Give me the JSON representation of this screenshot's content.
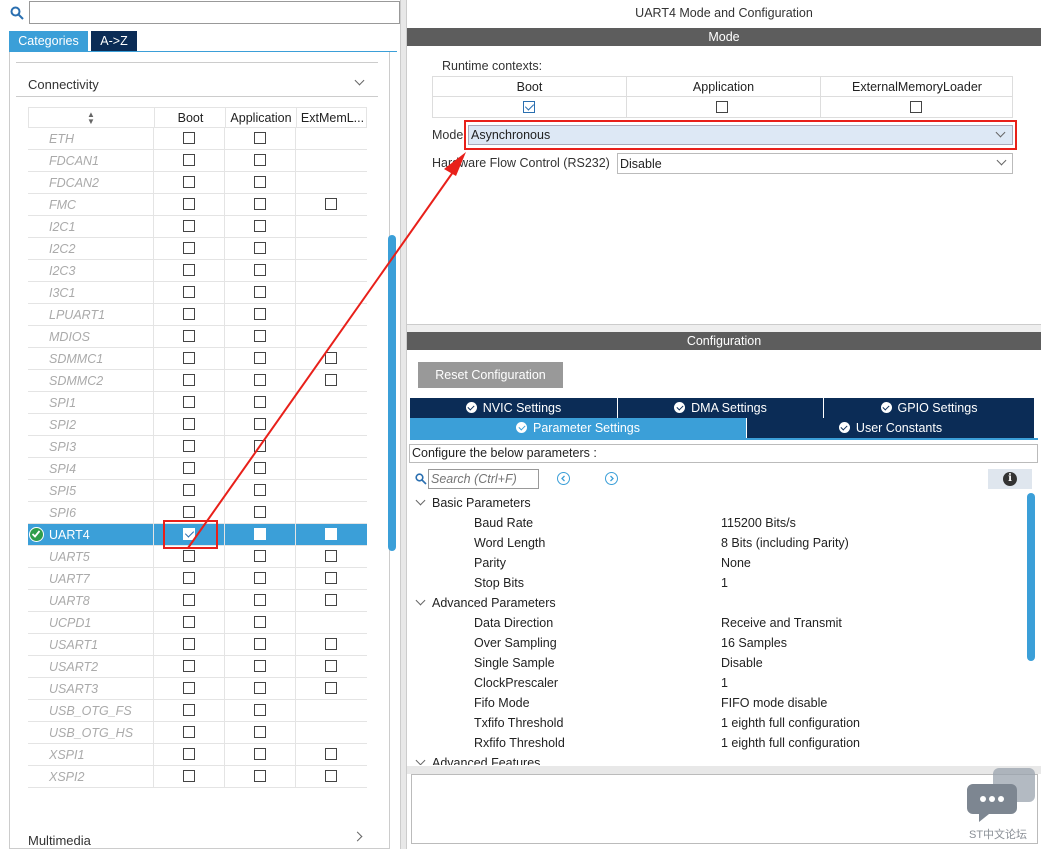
{
  "left": {
    "search_placeholder": "",
    "tabs": [
      "Categories",
      "A->Z"
    ],
    "group_title": "Connectivity",
    "bottom_group": "Multimedia",
    "columns": {
      "boot": "Boot",
      "application": "Application",
      "extmem": "ExtMemL..."
    },
    "rows": [
      {
        "name": "ETH",
        "boot": false,
        "app": false,
        "ext": null
      },
      {
        "name": "FDCAN1",
        "boot": false,
        "app": false,
        "ext": null
      },
      {
        "name": "FDCAN2",
        "boot": false,
        "app": false,
        "ext": null
      },
      {
        "name": "FMC",
        "boot": false,
        "app": false,
        "ext": false
      },
      {
        "name": "I2C1",
        "boot": false,
        "app": false,
        "ext": null
      },
      {
        "name": "I2C2",
        "boot": false,
        "app": false,
        "ext": null
      },
      {
        "name": "I2C3",
        "boot": false,
        "app": false,
        "ext": null
      },
      {
        "name": "I3C1",
        "boot": false,
        "app": false,
        "ext": null
      },
      {
        "name": "LPUART1",
        "boot": false,
        "app": false,
        "ext": null
      },
      {
        "name": "MDIOS",
        "boot": false,
        "app": false,
        "ext": null
      },
      {
        "name": "SDMMC1",
        "boot": false,
        "app": false,
        "ext": false
      },
      {
        "name": "SDMMC2",
        "boot": false,
        "app": false,
        "ext": false
      },
      {
        "name": "SPI1",
        "boot": false,
        "app": false,
        "ext": null
      },
      {
        "name": "SPI2",
        "boot": false,
        "app": false,
        "ext": null
      },
      {
        "name": "SPI3",
        "boot": false,
        "app": false,
        "ext": null
      },
      {
        "name": "SPI4",
        "boot": false,
        "app": false,
        "ext": null
      },
      {
        "name": "SPI5",
        "boot": false,
        "app": false,
        "ext": null
      },
      {
        "name": "SPI6",
        "boot": false,
        "app": false,
        "ext": null
      },
      {
        "name": "UART4",
        "boot": true,
        "app": false,
        "ext": false,
        "selected": true
      },
      {
        "name": "UART5",
        "boot": false,
        "app": false,
        "ext": false
      },
      {
        "name": "UART7",
        "boot": false,
        "app": false,
        "ext": false
      },
      {
        "name": "UART8",
        "boot": false,
        "app": false,
        "ext": false
      },
      {
        "name": "UCPD1",
        "boot": false,
        "app": false,
        "ext": null
      },
      {
        "name": "USART1",
        "boot": false,
        "app": false,
        "ext": false
      },
      {
        "name": "USART2",
        "boot": false,
        "app": false,
        "ext": false
      },
      {
        "name": "USART3",
        "boot": false,
        "app": false,
        "ext": false
      },
      {
        "name": "USB_OTG_FS",
        "boot": false,
        "app": false,
        "ext": null
      },
      {
        "name": "USB_OTG_HS",
        "boot": false,
        "app": false,
        "ext": null
      },
      {
        "name": "XSPI1",
        "boot": false,
        "app": false,
        "ext": false
      },
      {
        "name": "XSPI2",
        "boot": false,
        "app": false,
        "ext": false
      }
    ]
  },
  "right": {
    "title": "UART4 Mode and Configuration",
    "mode_header": "Mode",
    "runtime_label": "Runtime contexts:",
    "runtime_cols": [
      "Boot",
      "Application",
      "ExternalMemoryLoader"
    ],
    "runtime_checked": [
      true,
      false,
      false
    ],
    "mode_label": "Mode",
    "mode_value": "Asynchronous",
    "hwfc_label": "Hardware Flow Control (RS232)",
    "hwfc_value": "Disable",
    "config_header": "Configuration",
    "reset_button": "Reset Configuration",
    "tabs_row1": [
      "NVIC Settings",
      "DMA Settings",
      "GPIO Settings"
    ],
    "tabs_row2": [
      "Parameter Settings",
      "User Constants"
    ],
    "configure_text": "Configure the below parameters :",
    "search_placeholder": "Search (Ctrl+F)",
    "groups": [
      {
        "name": "Basic Parameters",
        "params": [
          {
            "k": "Baud Rate",
            "v": "115200 Bits/s"
          },
          {
            "k": "Word Length",
            "v": "8 Bits (including Parity)"
          },
          {
            "k": "Parity",
            "v": "None"
          },
          {
            "k": "Stop Bits",
            "v": "1"
          }
        ]
      },
      {
        "name": "Advanced Parameters",
        "params": [
          {
            "k": "Data Direction",
            "v": "Receive and Transmit"
          },
          {
            "k": "Over Sampling",
            "v": "16 Samples"
          },
          {
            "k": "Single Sample",
            "v": "Disable"
          },
          {
            "k": "ClockPrescaler",
            "v": "1"
          },
          {
            "k": "Fifo Mode",
            "v": "FIFO mode disable"
          },
          {
            "k": "Txfifo Threshold",
            "v": "1 eighth full configuration"
          },
          {
            "k": "Rxfifo Threshold",
            "v": "1 eighth full configuration"
          }
        ]
      },
      {
        "name": "Advanced Features",
        "params": []
      }
    ],
    "watermark": "ST中文论坛"
  },
  "colors": {
    "accent": "#3b9fd8",
    "navy": "#0b2c56",
    "header_gray": "#5d5d5d",
    "annotation_red": "#e8201a"
  }
}
